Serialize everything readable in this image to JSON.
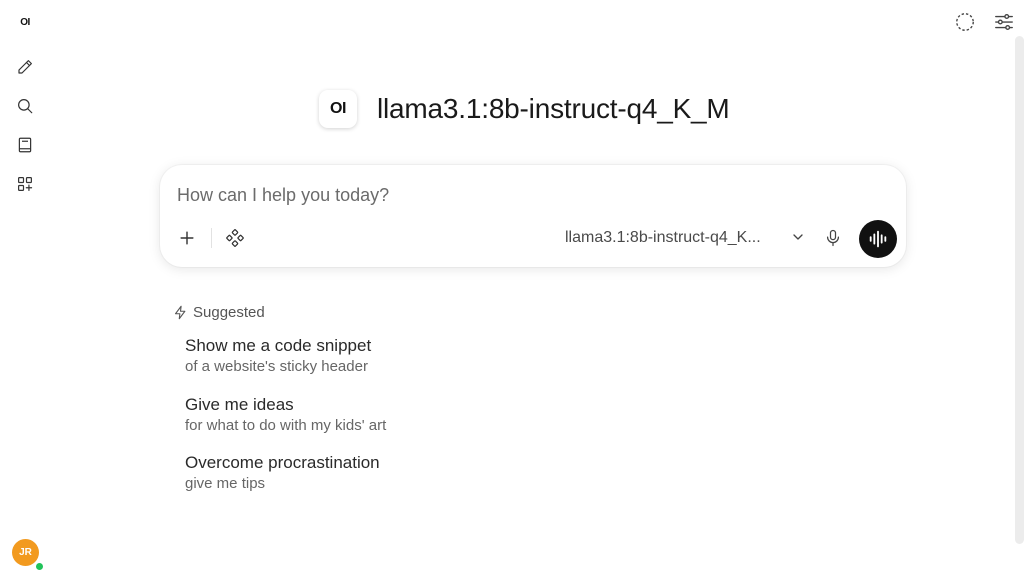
{
  "sidebar": {
    "logo_text": "OI",
    "items": [
      {
        "icon": "pencil-icon",
        "label": "New chat"
      },
      {
        "icon": "search-icon",
        "label": "Search"
      },
      {
        "icon": "notebook-icon",
        "label": "Notes"
      },
      {
        "icon": "apps-icon",
        "label": "Workspace"
      }
    ],
    "user": {
      "initials": "JR",
      "avatar_color": "#f29a1f",
      "status_color": "#21c35a"
    }
  },
  "topbar": {
    "icons": [
      "temporary-chat-icon",
      "controls-icon"
    ]
  },
  "header": {
    "logo_text": "OI",
    "model_name": "llama3.1:8b-instruct-q4_K_M"
  },
  "chat": {
    "placeholder": "How can I help you today?",
    "value": "",
    "model_selected": "llama3.1:8b-instruct-q4_K...",
    "icons": [
      "plus-icon",
      "tools-icon",
      "chevron-down-icon",
      "microphone-icon",
      "voice-waveform-icon"
    ]
  },
  "suggested": {
    "label": "Suggested",
    "items": [
      {
        "title": "Show me a code snippet",
        "subtitle": "of a website's sticky header"
      },
      {
        "title": "Give me ideas",
        "subtitle": "for what to do with my kids' art"
      },
      {
        "title": "Overcome procrastination",
        "subtitle": "give me tips"
      }
    ]
  },
  "colors": {
    "accent_dark": "#111111",
    "text_primary": "#1f1f1f",
    "text_secondary": "#666666"
  }
}
